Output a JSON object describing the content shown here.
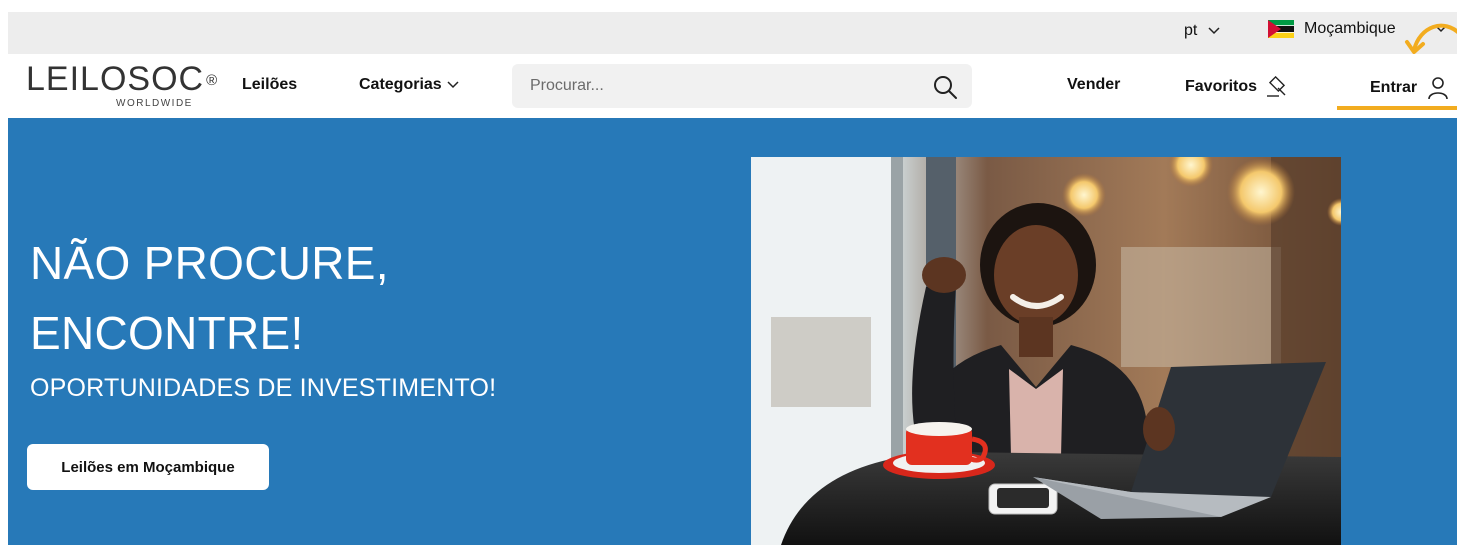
{
  "topbar": {
    "language": "pt",
    "country": "Moçambique"
  },
  "header": {
    "logo_main": "LEILOSOC",
    "logo_registered": "®",
    "logo_sub": "WORLDWIDE",
    "nav": {
      "auctions": "Leilões",
      "categories": "Categorias"
    },
    "search": {
      "placeholder": "Procurar..."
    },
    "sell": "Vender",
    "favorites": "Favoritos",
    "login": "Entrar"
  },
  "hero": {
    "title_line1": "NÃO PROCURE,",
    "title_line2": "ENCONTRE!",
    "subtitle": "OPORTUNIDADES DE INVESTIMENTO!",
    "cta_label": "Leilões em Moçambique"
  },
  "colors": {
    "hero_bg": "#2779b8",
    "accent": "#f2ac1f",
    "topbar_bg": "#ededed"
  },
  "icons": [
    "chevron-down-icon",
    "mozambique-flag-icon",
    "search-icon",
    "gavel-icon",
    "user-icon"
  ]
}
